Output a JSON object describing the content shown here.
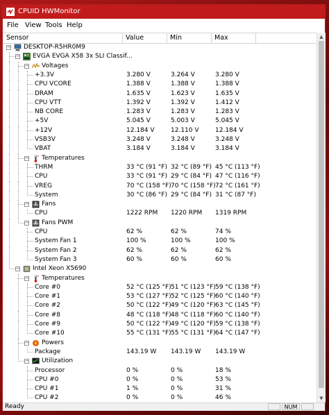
{
  "window": {
    "title": "CPUID HWMonitor"
  },
  "menu": [
    "File",
    "View",
    "Tools",
    "Help"
  ],
  "columns": [
    "Sensor",
    "Value",
    "Min",
    "Max"
  ],
  "status": {
    "text": "Ready",
    "num": "NUM"
  },
  "tree": [
    {
      "level": 0,
      "icon": "computer-icon",
      "label": "DESKTOP-R5HR0M9",
      "value": "",
      "min": "",
      "max": ""
    },
    {
      "level": 1,
      "icon": "motherboard-icon",
      "label": "EVGA EVGA X58 3x SLI Classif...",
      "value": "",
      "min": "",
      "max": ""
    },
    {
      "level": 2,
      "icon": "voltage-icon",
      "label": "Voltages",
      "value": "",
      "min": "",
      "max": ""
    },
    {
      "level": 3,
      "label": "+3.3V",
      "value": "3.280 V",
      "min": "3.264 V",
      "max": "3.280 V"
    },
    {
      "level": 3,
      "label": "CPU VCORE",
      "value": "1.388 V",
      "min": "1.388 V",
      "max": "1.388 V"
    },
    {
      "level": 3,
      "label": "DRAM",
      "value": "1.635 V",
      "min": "1.623 V",
      "max": "1.635 V"
    },
    {
      "level": 3,
      "label": "CPU VTT",
      "value": "1.392 V",
      "min": "1.392 V",
      "max": "1.412 V"
    },
    {
      "level": 3,
      "label": "NB CORE",
      "value": "1.283 V",
      "min": "1.283 V",
      "max": "1.283 V"
    },
    {
      "level": 3,
      "label": "+5V",
      "value": "5.045 V",
      "min": "5.003 V",
      "max": "5.045 V"
    },
    {
      "level": 3,
      "label": "+12V",
      "value": "12.184 V",
      "min": "12.110 V",
      "max": "12.184 V"
    },
    {
      "level": 3,
      "label": "VSB3V",
      "value": "3.248 V",
      "min": "3.248 V",
      "max": "3.248 V"
    },
    {
      "level": 3,
      "label": "VBAT",
      "value": "3.184 V",
      "min": "3.184 V",
      "max": "3.184 V"
    },
    {
      "level": 2,
      "icon": "thermometer-icon",
      "label": "Temperatures",
      "value": "",
      "min": "",
      "max": ""
    },
    {
      "level": 3,
      "label": "THRM",
      "value": "33 °C  (91 °F)",
      "min": "32 °C  (89 °F)",
      "max": "45 °C  (113 °F)"
    },
    {
      "level": 3,
      "label": "CPU",
      "value": "33 °C  (91 °F)",
      "min": "29 °C  (84 °F)",
      "max": "47 °C  (116 °F)"
    },
    {
      "level": 3,
      "label": "VREG",
      "value": "70 °C  (158 °F)",
      "min": "70 °C  (158 °F)",
      "max": "72 °C  (161 °F)"
    },
    {
      "level": 3,
      "label": "System",
      "value": "30 °C  (86 °F)",
      "min": "29 °C  (84 °F)",
      "max": "31 °C  (87 °F)"
    },
    {
      "level": 2,
      "icon": "fan-icon",
      "label": "Fans",
      "value": "",
      "min": "",
      "max": ""
    },
    {
      "level": 3,
      "label": "CPU",
      "value": "1222 RPM",
      "min": "1220 RPM",
      "max": "1319 RPM"
    },
    {
      "level": 2,
      "icon": "fan-pwm-icon",
      "label": "Fans PWM",
      "value": "",
      "min": "",
      "max": ""
    },
    {
      "level": 3,
      "label": "CPU",
      "value": "62 %",
      "min": "62 %",
      "max": "74 %"
    },
    {
      "level": 3,
      "label": "System Fan 1",
      "value": "100 %",
      "min": "100 %",
      "max": "100 %"
    },
    {
      "level": 3,
      "label": "System Fan 2",
      "value": "62 %",
      "min": "62 %",
      "max": "62 %"
    },
    {
      "level": 3,
      "label": "System Fan 3",
      "value": "60 %",
      "min": "60 %",
      "max": "60 %"
    },
    {
      "level": 1,
      "icon": "cpu-chip-icon",
      "label": "Intel Xeon X5690",
      "value": "",
      "min": "",
      "max": ""
    },
    {
      "level": 2,
      "icon": "thermometer-icon",
      "label": "Temperatures",
      "value": "",
      "min": "",
      "max": ""
    },
    {
      "level": 3,
      "label": "Core #0",
      "value": "52 °C  (125 °F)",
      "min": "51 °C  (123 °F)",
      "max": "59 °C  (138 °F)"
    },
    {
      "level": 3,
      "label": "Core #1",
      "value": "53 °C  (127 °F)",
      "min": "52 °C  (125 °F)",
      "max": "60 °C  (140 °F)"
    },
    {
      "level": 3,
      "label": "Core #2",
      "value": "50 °C  (122 °F)",
      "min": "49 °C  (120 °F)",
      "max": "63 °C  (145 °F)"
    },
    {
      "level": 3,
      "label": "Core #8",
      "value": "48 °C  (118 °F)",
      "min": "48 °C  (118 °F)",
      "max": "60 °C  (140 °F)"
    },
    {
      "level": 3,
      "label": "Core #9",
      "value": "50 °C  (122 °F)",
      "min": "49 °C  (120 °F)",
      "max": "59 °C  (138 °F)"
    },
    {
      "level": 3,
      "label": "Core #10",
      "value": "55 °C  (131 °F)",
      "min": "55 °C  (131 °F)",
      "max": "64 °C  (147 °F)"
    },
    {
      "level": 2,
      "icon": "power-icon",
      "label": "Powers",
      "value": "",
      "min": "",
      "max": ""
    },
    {
      "level": 3,
      "label": "Package",
      "value": "143.19 W",
      "min": "143.19 W",
      "max": "143.19 W"
    },
    {
      "level": 2,
      "icon": "utilization-icon",
      "label": "Utilization",
      "value": "",
      "min": "",
      "max": ""
    },
    {
      "level": 3,
      "label": "Processor",
      "value": "0 %",
      "min": "0 %",
      "max": "18 %"
    },
    {
      "level": 3,
      "label": "CPU #0",
      "value": "0 %",
      "min": "0 %",
      "max": "53 %"
    },
    {
      "level": 3,
      "label": "CPU #1",
      "value": "1 %",
      "min": "0 %",
      "max": "31 %"
    },
    {
      "level": 3,
      "label": "CPU #2",
      "value": "0 %",
      "min": "0 %",
      "max": "46 %"
    }
  ]
}
